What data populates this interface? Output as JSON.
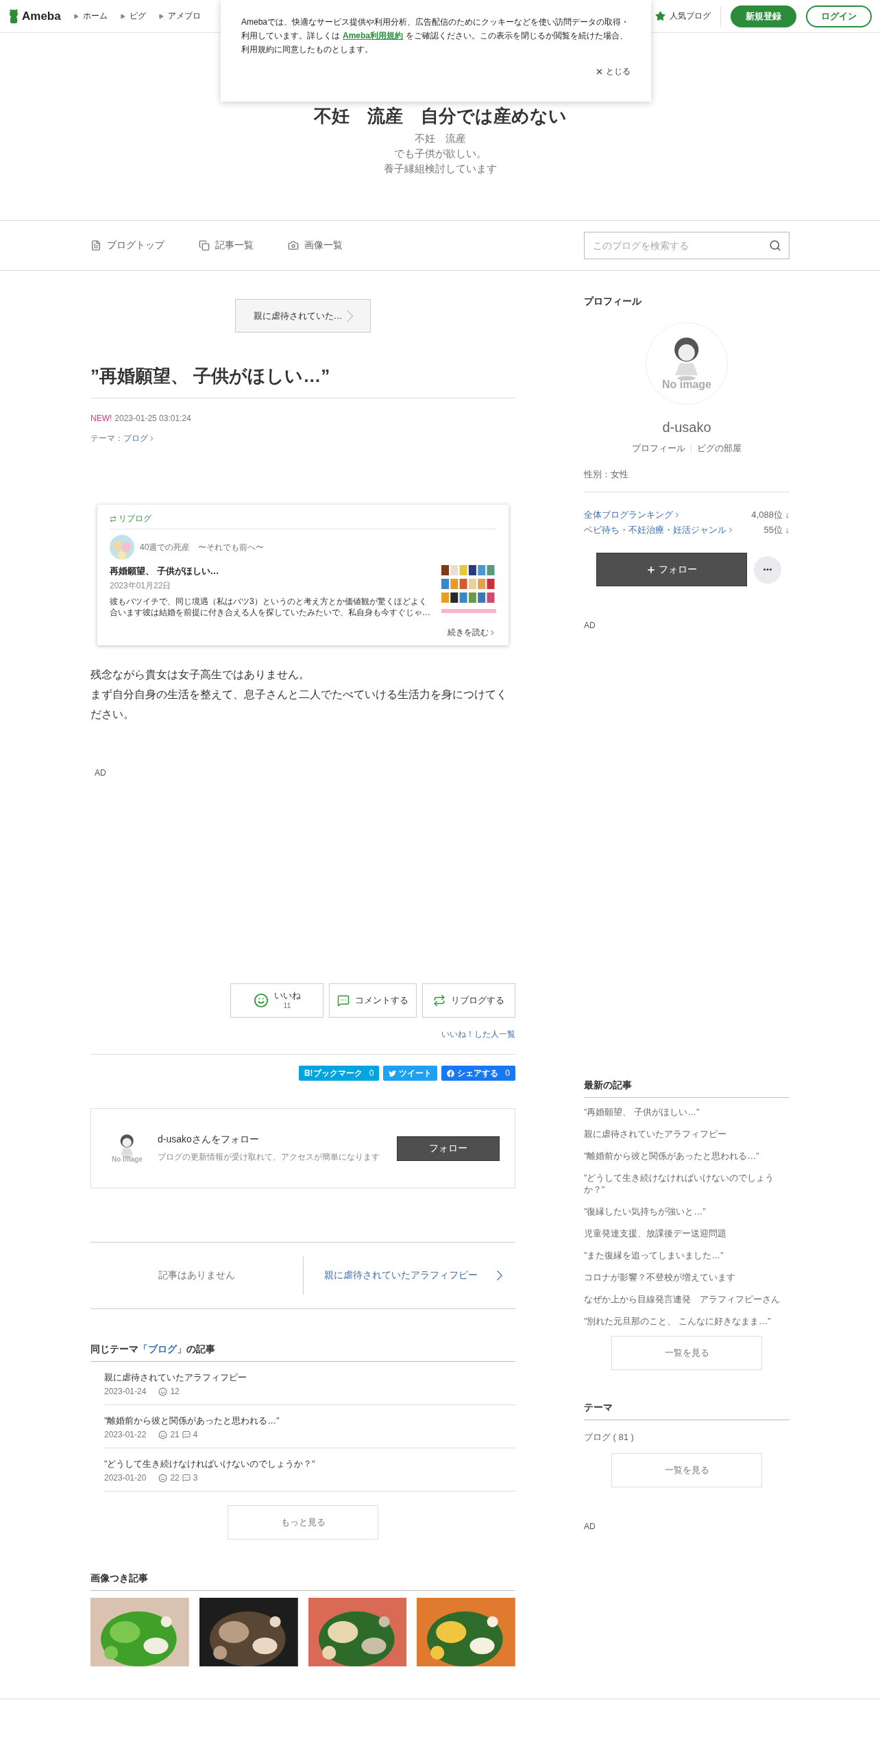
{
  "header": {
    "logo": "Ameba",
    "nav": [
      "ホーム",
      "ピグ",
      "アメブロ"
    ],
    "popular": "人気ブログ",
    "signup": "新規登録",
    "login": "ログイン"
  },
  "cookie_notice": {
    "text_before": "Amebaでは、快適なサービス提供や利用分析、広告配信のためにクッキーなどを使い訪問データの取得・利用しています。詳しくは",
    "link": "Ameba利用規約",
    "text_after": "をご確認ください。この表示を閉じるか閲覧を続けた場合、利用規約に同意したものとします。",
    "close": "とじる"
  },
  "blog": {
    "title": "不妊　流産　自分では産めない",
    "description": [
      "不妊　流産",
      "でも子供が欲しい。",
      "養子縁組検討しています"
    ]
  },
  "blog_nav": {
    "items": [
      {
        "kind": "top",
        "label": "ブログトップ"
      },
      {
        "kind": "list",
        "label": "記事一覧"
      },
      {
        "kind": "images",
        "label": "画像一覧"
      }
    ],
    "search": {
      "placeholder": "このブログを検索する"
    }
  },
  "article": {
    "prev": "親に虐待されていた…",
    "title": "”再婚願望、 子供がほしい…”",
    "new_badge": "NEW!",
    "datetime": "2023-01-25 03:01:24",
    "theme_label": "テーマ：",
    "theme": "ブログ",
    "reblog": {
      "header": "リブログ",
      "blog_name": "40週での死産　〜それでも前へ〜",
      "title": "再婚願望、 子供がほしい…",
      "date": "2023年01月22日",
      "excerpt": "彼もバツイチで、同じ境遇（私はバツ3）というのと考え方とか価値観が驚くほどよく合います彼は結婚を前提に付き合える人を探していたみたいで、私自身も今すぐじゃ…",
      "more": "続きを読む"
    },
    "body": [
      "残念ながら貴女は女子高生ではありません。",
      "まず自分自身の生活を整えて、息子さんと二人でたべていける生活力を身につけてください。"
    ],
    "ad": "AD",
    "actions": [
      {
        "kind": "like",
        "label": "いいね",
        "count": "11"
      },
      {
        "kind": "comment",
        "label": "コメントする"
      },
      {
        "kind": "reblog",
        "label": "リブログする"
      }
    ],
    "likers_link": "いいね！した人一覧",
    "share": [
      {
        "kind": "hatena",
        "label": "B!ブックマーク",
        "count": "0",
        "color": "#00a4de"
      },
      {
        "kind": "twitter",
        "label": "ツイート",
        "color": "#1da1f2"
      },
      {
        "kind": "facebook",
        "label": "シェアする",
        "count": "0",
        "color": "#1877f2"
      }
    ],
    "follow_box": {
      "no_image": "No image",
      "title": "d-usakoさんをフォロー",
      "text": "ブログの更新情報が受け取れて、アクセスが簡単になります",
      "button": "フォロー"
    },
    "pager": {
      "prev": "記事はありません",
      "next": "親に虐待されていたアラフィフピー"
    }
  },
  "same_theme": {
    "prefix": "同じテーマ",
    "theme": "「ブログ」",
    "suffix": "の記事",
    "rows": [
      {
        "title": "親に虐待されていたアラフィフピー",
        "date": "2023-01-24",
        "likes": "12"
      },
      {
        "title": "”離婚前から彼と関係があったと思われる…”",
        "date": "2023-01-22",
        "likes": "21",
        "comments": "4"
      },
      {
        "title": "”どうして生き続けなければいけないのでしょうか？”",
        "date": "2023-01-20",
        "likes": "22",
        "comments": "3"
      }
    ],
    "more": "もっと見る"
  },
  "image_articles": {
    "title": "画像つき記事",
    "items": [
      {
        "kind": "pepper"
      },
      {
        "kind": "grill"
      },
      {
        "kind": "salad"
      },
      {
        "kind": "noodle"
      }
    ]
  },
  "sidebar": {
    "profile": {
      "heading": "プロフィール",
      "no_image": "No image",
      "name": "d-usako",
      "links": [
        "プロフィール",
        "ピグの部屋"
      ],
      "gender": "性別：女性",
      "rankings": [
        {
          "label": "全体ブログランキング",
          "rank": "4,088位",
          "trend": "↓"
        },
        {
          "label": "ベビ待ち・不妊治療・妊活ジャンル",
          "rank": "55位",
          "trend": "↓"
        }
      ],
      "follow": "フォロー",
      "ad": "AD"
    },
    "latest": {
      "heading": "最新の記事",
      "items": [
        "”再婚願望、 子供がほしい…”",
        "親に虐待されていたアラフィフピー",
        "”離婚前から彼と関係があったと思われる…”",
        "”どうして生き続けなければいけないのでしょうか？”",
        "”復縁したい気持ちが強いと…”",
        "児童発達支援、放課後デー送迎問題",
        "”また復縁を追ってしまいました…”",
        "コロナが影響？不登校が増えています",
        "なぜか上から目線発言連発　アラフィフピーさん",
        "”別れた元旦那のこと、 こんなに好きなまま…”"
      ],
      "more": "一覧を見る"
    },
    "themes": {
      "heading": "テーマ",
      "items": [
        "ブログ ( 81 )"
      ],
      "more": "一覧を見る"
    },
    "ad": "AD"
  }
}
